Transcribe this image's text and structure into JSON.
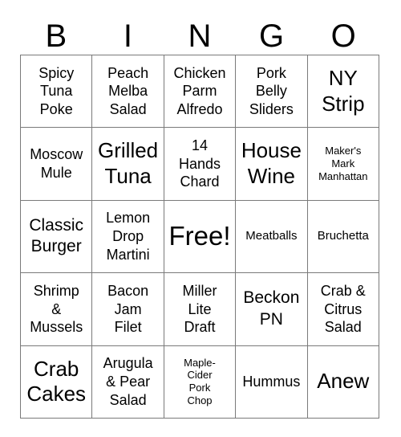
{
  "card": {
    "title": "BINGO",
    "header_letters": [
      "B",
      "I",
      "N",
      "G",
      "O"
    ],
    "free_space_label": "Free!",
    "colors": {
      "text": "#000000",
      "background": "#ffffff",
      "grid_line": "#7a7a7a"
    },
    "rows": [
      [
        {
          "text": "Spicy\nTuna\nPoke",
          "size": "md"
        },
        {
          "text": "Peach\nMelba\nSalad",
          "size": "md"
        },
        {
          "text": "Chicken\nParm\nAlfredo",
          "size": "md"
        },
        {
          "text": "Pork\nBelly\nSliders",
          "size": "md"
        },
        {
          "text": "NY\nStrip",
          "size": "xl"
        }
      ],
      [
        {
          "text": "Moscow\nMule",
          "size": "md"
        },
        {
          "text": "Grilled\nTuna",
          "size": "xl"
        },
        {
          "text": "14\nHands\nChard",
          "size": "md"
        },
        {
          "text": "House\nWine",
          "size": "xl"
        },
        {
          "text": "Maker's\nMark\nManhattan",
          "size": "xs"
        }
      ],
      [
        {
          "text": "Classic\nBurger",
          "size": "lg"
        },
        {
          "text": "Lemon\nDrop\nMartini",
          "size": "md"
        },
        {
          "text": "Free!",
          "size": "xxl"
        },
        {
          "text": "Meatballs",
          "size": "sm"
        },
        {
          "text": "Bruchetta",
          "size": "sm"
        }
      ],
      [
        {
          "text": "Shrimp\n&\nMussels",
          "size": "md"
        },
        {
          "text": "Bacon\nJam\nFilet",
          "size": "md"
        },
        {
          "text": "Miller\nLite\nDraft",
          "size": "md"
        },
        {
          "text": "Beckon\nPN",
          "size": "lg"
        },
        {
          "text": "Crab &\nCitrus\nSalad",
          "size": "md"
        }
      ],
      [
        {
          "text": "Crab\nCakes",
          "size": "xl"
        },
        {
          "text": "Arugula\n& Pear\nSalad",
          "size": "md"
        },
        {
          "text": "Maple-\nCider\nPork\nChop",
          "size": "xs"
        },
        {
          "text": "Hummus",
          "size": "md"
        },
        {
          "text": "Anew",
          "size": "xl"
        }
      ]
    ]
  }
}
